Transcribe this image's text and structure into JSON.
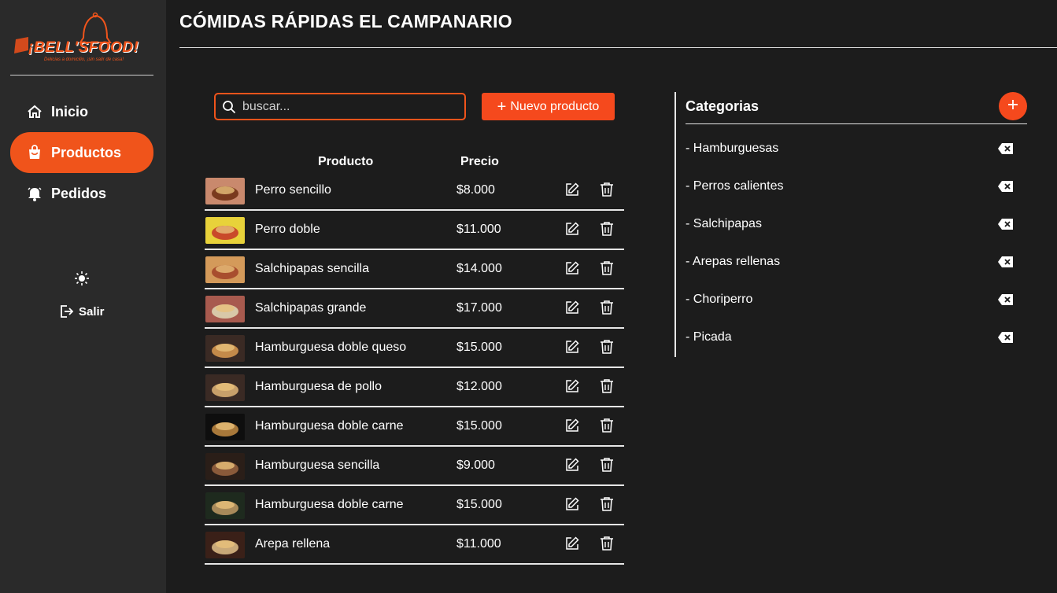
{
  "brand": {
    "logo_text": "¡BELL'SFOOD!",
    "tagline": "Delicias a domicilio, ¡sin salir de casa!"
  },
  "sidebar": {
    "items": [
      {
        "label": "Inicio",
        "icon": "home-icon",
        "active": false
      },
      {
        "label": "Productos",
        "icon": "shopping-bag-icon",
        "active": true
      },
      {
        "label": "Pedidos",
        "icon": "bell-icon",
        "active": false
      }
    ],
    "theme_icon": "sun-icon",
    "logout_label": "Salir"
  },
  "header": {
    "title": "CÓMIDAS RÁPIDAS EL CAMPANARIO"
  },
  "search": {
    "placeholder": "buscar..."
  },
  "new_product_label": "Nuevo producto",
  "table": {
    "columns": [
      "Producto",
      "Precio"
    ],
    "rows": [
      {
        "name": "Perro sencillo",
        "price": "$8.000"
      },
      {
        "name": "Perro doble",
        "price": "$11.000"
      },
      {
        "name": "Salchipapas sencilla",
        "price": "$14.000"
      },
      {
        "name": "Salchipapas grande",
        "price": "$17.000"
      },
      {
        "name": "Hamburguesa doble queso",
        "price": "$15.000"
      },
      {
        "name": "Hamburguesa de pollo",
        "price": "$12.000"
      },
      {
        "name": "Hamburguesa doble carne",
        "price": "$15.000"
      },
      {
        "name": "Hamburguesa sencilla",
        "price": "$9.000"
      },
      {
        "name": "Hamburguesa doble carne",
        "price": "$15.000"
      },
      {
        "name": "Arepa rellena",
        "price": "$11.000"
      }
    ]
  },
  "categories": {
    "title": "Categorias",
    "items": [
      "- Hamburguesas",
      "- Perros calientes",
      "- Salchipapas",
      "- Arepas rellenas",
      "- Choriperro",
      "- Picada"
    ]
  },
  "colors": {
    "accent": "#f0541b",
    "background": "#1c1c1c",
    "sidebar": "#2a2a2a"
  }
}
